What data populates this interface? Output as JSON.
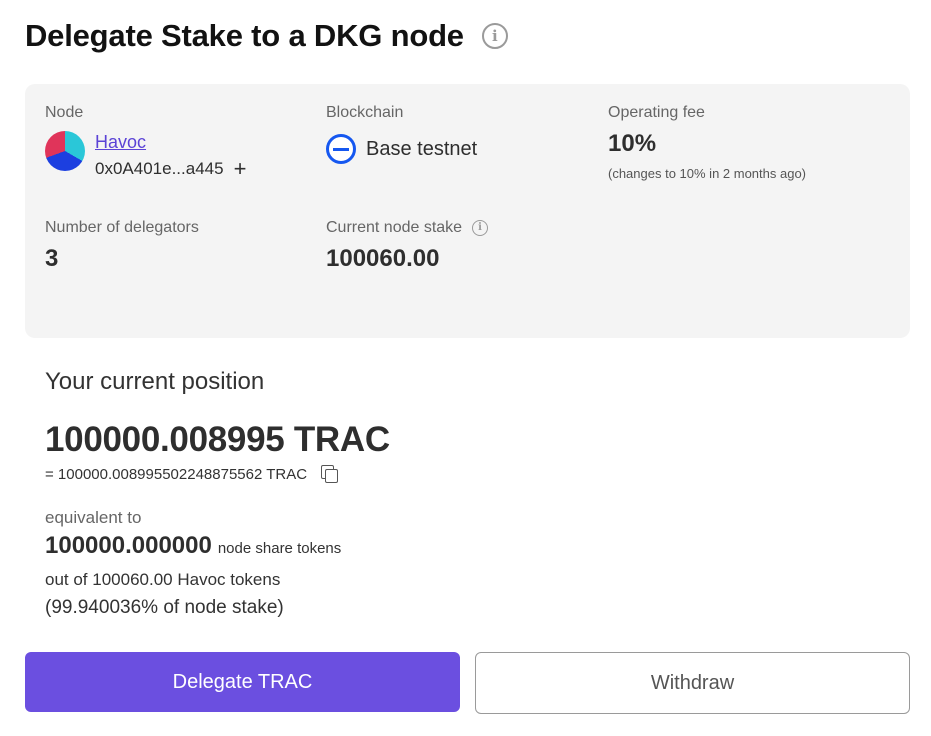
{
  "header": {
    "title": "Delegate Stake to a DKG node",
    "info_icon": "info-icon"
  },
  "node_card": {
    "node_label": "Node",
    "node_name": "Havoc",
    "node_address": "0x0A401e...a445",
    "node_address_action": "+",
    "blockchain_label": "Blockchain",
    "blockchain_name": "Base testnet",
    "operating_fee_label": "Operating fee",
    "operating_fee_value": "10%",
    "operating_fee_note": "(changes to 10% in 2 months ago)",
    "delegators_label": "Number of delegators",
    "delegators_value": "3",
    "stake_label": "Current node stake",
    "stake_value": "100060.00"
  },
  "position": {
    "title": "Your current position",
    "amount": "100000.008995 TRAC",
    "exact_amount": "= 100000.008995502248875562 TRAC",
    "equivalent_label": "equivalent to",
    "share_tokens": "100000.000000",
    "share_tokens_unit": "node share tokens",
    "out_of": "out of 100060.00 Havoc tokens",
    "percent_of_stake": "(99.940036% of node stake)"
  },
  "actions": {
    "delegate_label": "Delegate TRAC",
    "withdraw_label": "Withdraw"
  },
  "colors": {
    "accent": "#6b4fe0",
    "link": "#5b43d6",
    "base_blue": "#1557f0",
    "card_bg": "#f4f4f4"
  }
}
